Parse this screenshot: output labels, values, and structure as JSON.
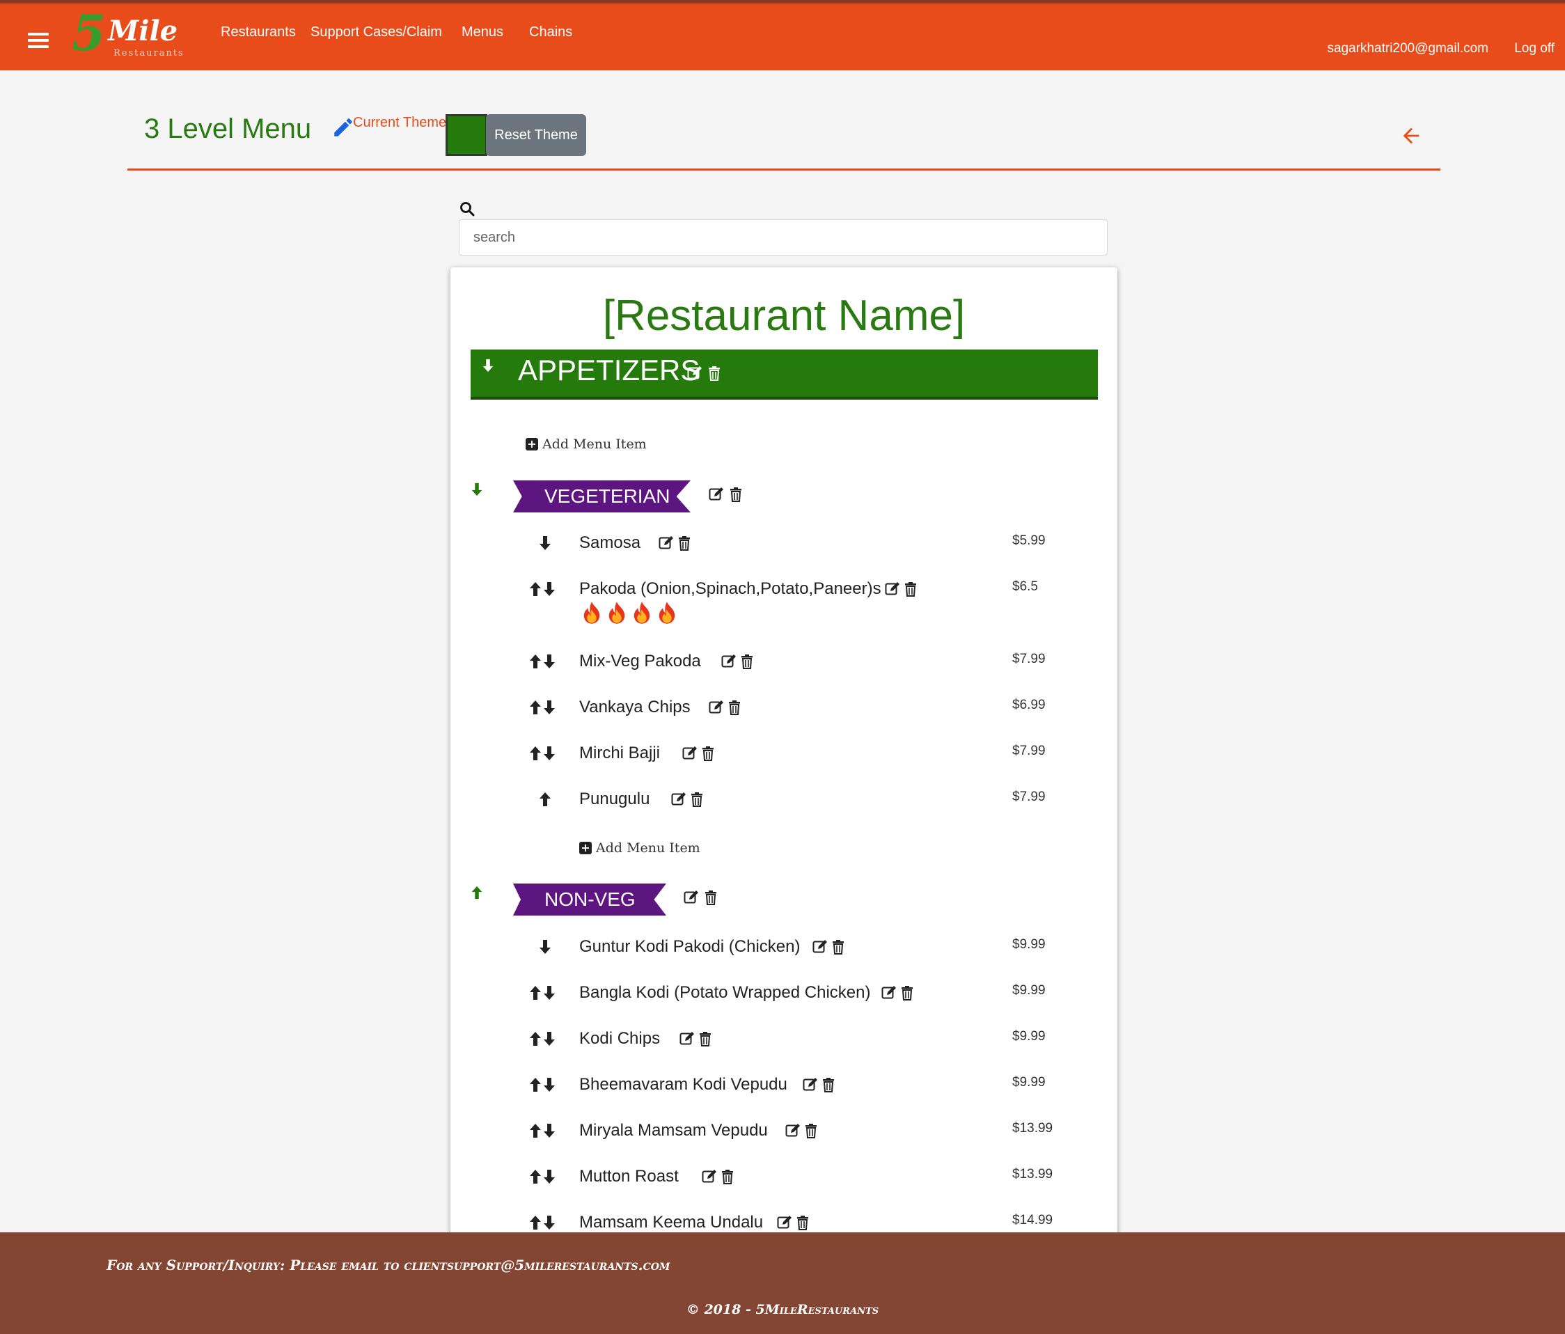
{
  "brand": {
    "logo_number": "5",
    "logo_word": "Mile",
    "logo_sub": "Restaurants"
  },
  "nav": {
    "restaurants": "Restaurants",
    "support": "Support Cases/Claim",
    "menus": "Menus",
    "chains": "Chains"
  },
  "user": {
    "email": "sagarkhatri200@gmail.com",
    "logoff": "Log off"
  },
  "header": {
    "title": "3 Level Menu",
    "theme_label": "Current Theme",
    "reset_label": "Reset Theme",
    "theme_color": "#257a0c"
  },
  "search": {
    "placeholder": "search"
  },
  "menu": {
    "restaurant_name": "[Restaurant Name]",
    "section_title": "APPETIZERS",
    "add_item_label": "Add Menu Item",
    "categories": [
      {
        "name": "VEGETERIAN",
        "items": [
          {
            "name": "Samosa",
            "price": "$5.99"
          },
          {
            "name": "Pakoda (Onion,Spinach,Potato,Paneer)s",
            "price": "$6.5",
            "spice_level": 4
          },
          {
            "name": "Mix-Veg Pakoda",
            "price": "$7.99"
          },
          {
            "name": "Vankaya Chips",
            "price": "$6.99"
          },
          {
            "name": "Mirchi Bajji",
            "price": "$7.99"
          },
          {
            "name": "Punugulu",
            "price": "$7.99"
          }
        ]
      },
      {
        "name": "NON-VEG",
        "items": [
          {
            "name": "Guntur Kodi Pakodi (Chicken)",
            "price": "$9.99"
          },
          {
            "name": "Bangla Kodi (Potato Wrapped Chicken)",
            "price": "$9.99"
          },
          {
            "name": "Kodi Chips",
            "price": "$9.99"
          },
          {
            "name": "Bheemavaram Kodi Vepudu",
            "price": "$9.99"
          },
          {
            "name": "Miryala Mamsam Vepudu",
            "price": "$13.99"
          },
          {
            "name": "Mutton Roast",
            "price": "$13.99"
          },
          {
            "name": "Mamsam Keema Undalu",
            "price": "$14.99"
          }
        ]
      }
    ]
  },
  "footer": {
    "support_text": "For any Support/Inquiry: Please email to clientsupport@5milerestaurants.com",
    "copyright": "© 2018 - 5MileRestaurants"
  },
  "colors": {
    "topbar": "#e84c1a",
    "accent_green": "#257a0c",
    "ribbon_purple": "#5d1680",
    "footer": "#834632"
  }
}
